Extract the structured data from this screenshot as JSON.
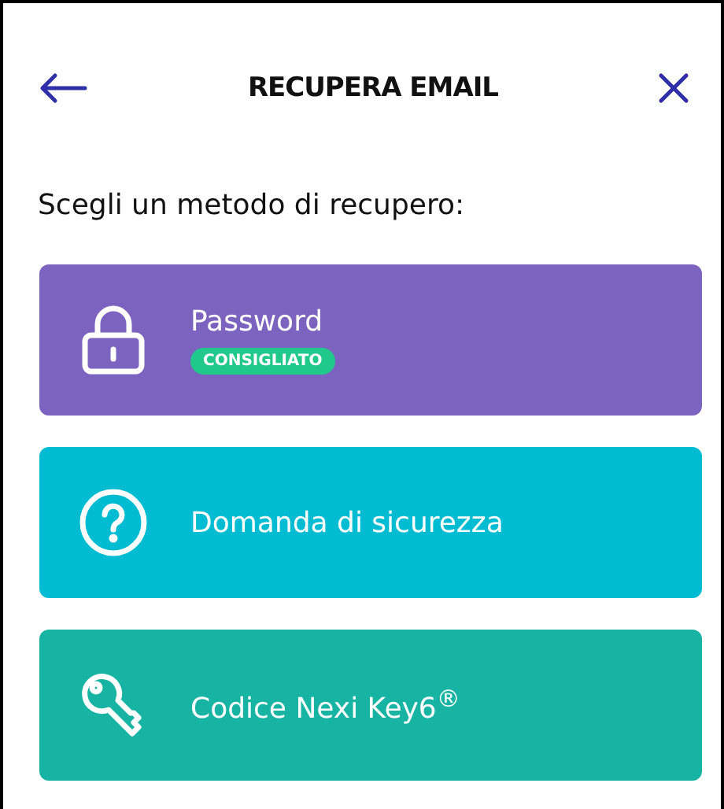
{
  "header": {
    "title": "RECUPERA EMAIL"
  },
  "prompt": "Scegli un metodo di recupero:",
  "methods": [
    {
      "kind": "lock",
      "label": "Password",
      "badge": "CONSIGLIATO",
      "color": "#7b63bf"
    },
    {
      "kind": "question",
      "label": "Domanda di sicurezza",
      "color": "#00bcd2"
    },
    {
      "kind": "key",
      "label": "Codice Nexi Key6$^{®}$",
      "color": "#17b3a3"
    }
  ]
}
